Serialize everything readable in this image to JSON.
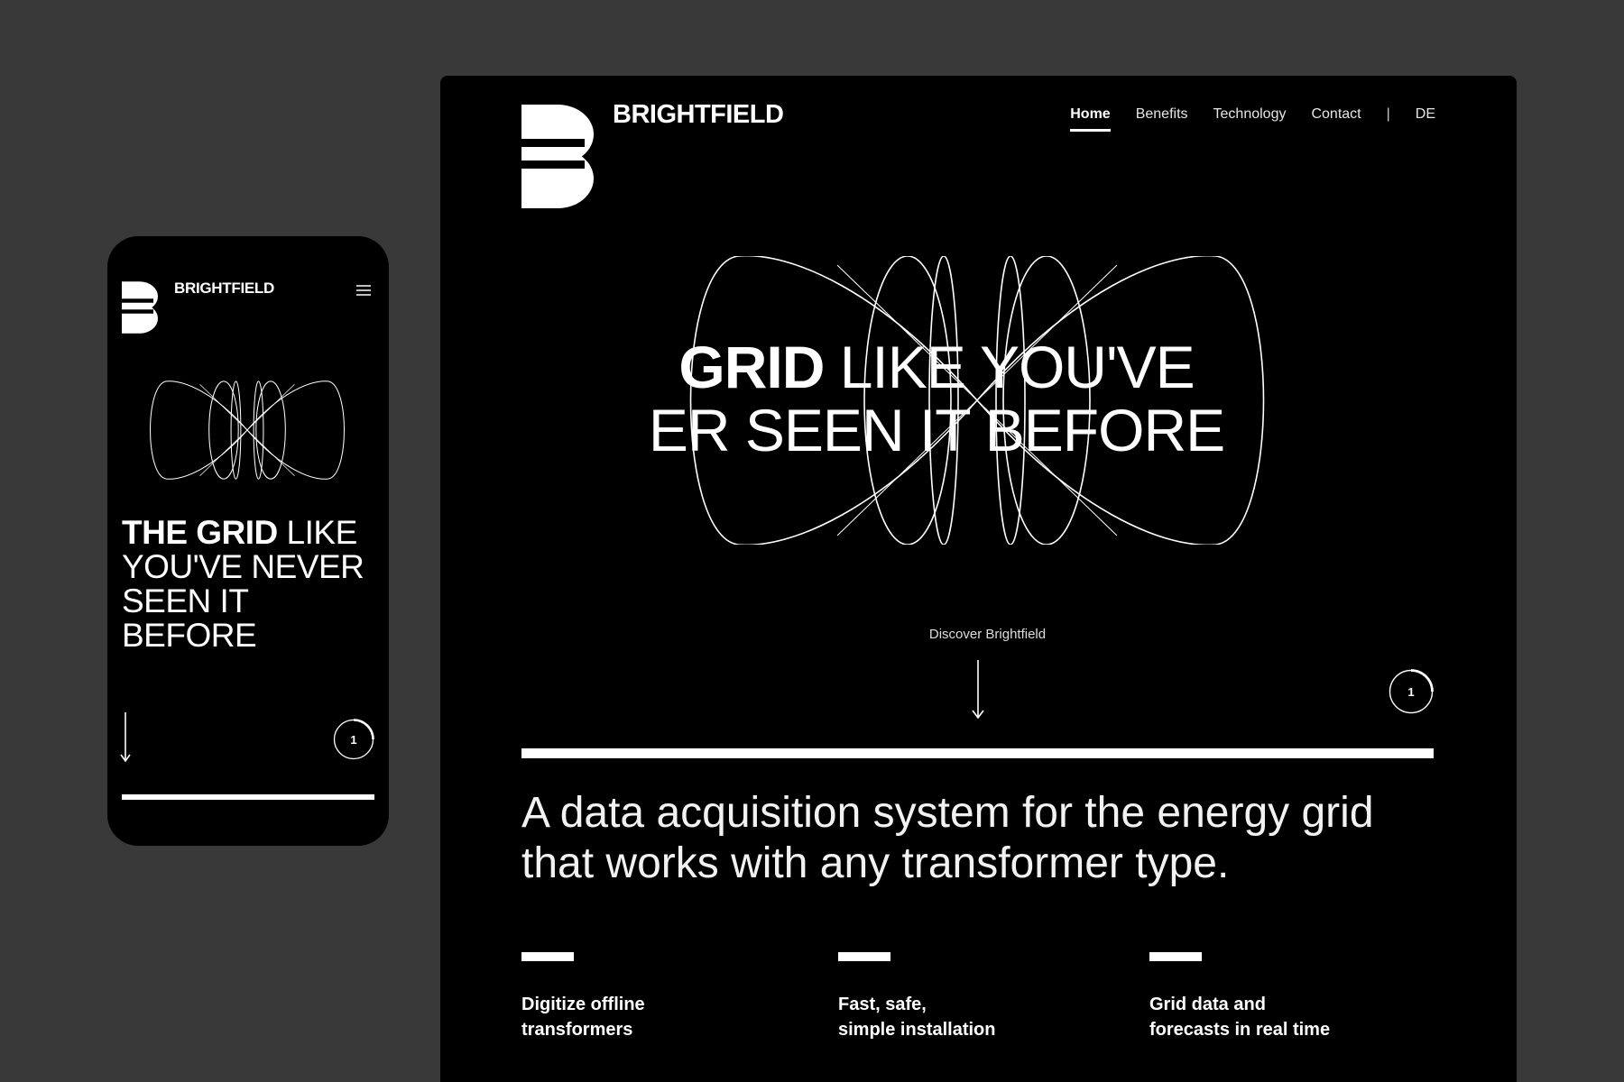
{
  "brand": {
    "name": "BRIGHTFIELD"
  },
  "desktop": {
    "nav": {
      "items": [
        {
          "label": "Home",
          "active": true
        },
        {
          "label": "Benefits",
          "active": false
        },
        {
          "label": "Technology",
          "active": false
        },
        {
          "label": "Contact",
          "active": false
        }
      ],
      "separator": "|",
      "language": "DE"
    },
    "hero": {
      "headline_bold": "GRID",
      "headline_rest_line1": " LIKE YOU'VE",
      "headline_line2": "ER SEEN IT BEFORE",
      "discover_label": "Discover Brightfield",
      "page_indicator": "1"
    },
    "lead_text": "A data acquisition system for the energy grid that works with any transformer type.",
    "features": [
      {
        "text": "Digitize offline\ntransformers"
      },
      {
        "text": "Fast, safe,\nsimple installation"
      },
      {
        "text": "Grid data and\nforecasts in real time"
      }
    ]
  },
  "mobile": {
    "hero": {
      "headline_bold": "THE GRID",
      "headline_rest": " LIKE YOU'VE NEVER SEEN IT BEFORE",
      "page_indicator": "1"
    }
  },
  "icons": {
    "logo": "brightfield-b-logo-icon",
    "menu": "hamburger-menu-icon",
    "arrow": "arrow-down-icon",
    "page_indicator": "progress-circle-icon"
  },
  "colors": {
    "backdrop": "#393939",
    "screen": "#000000",
    "foreground": "#ffffff"
  }
}
